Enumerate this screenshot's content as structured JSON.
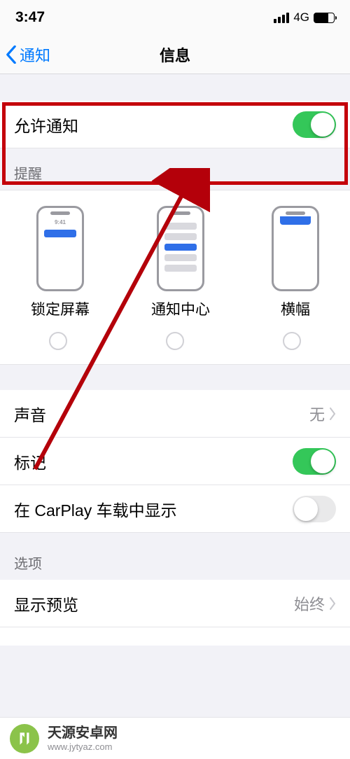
{
  "status": {
    "time": "3:47",
    "network": "4G"
  },
  "nav": {
    "back_label": "通知",
    "title": "信息"
  },
  "allow_notifications": {
    "label": "允许通知",
    "on": true
  },
  "alerts": {
    "header": "提醒",
    "options": [
      {
        "label": "锁定屏幕",
        "mock_time": "9:41"
      },
      {
        "label": "通知中心"
      },
      {
        "label": "横幅"
      }
    ]
  },
  "rows": {
    "sound": {
      "label": "声音",
      "value": "无"
    },
    "badges": {
      "label": "标记",
      "on": true
    },
    "carplay": {
      "label": "在 CarPlay 车载中显示",
      "on": false
    }
  },
  "options": {
    "header": "选项",
    "show_previews": {
      "label": "显示预览",
      "value": "始终"
    }
  },
  "watermark": {
    "title": "天源安卓网",
    "url": "www.jytyaz.com"
  }
}
